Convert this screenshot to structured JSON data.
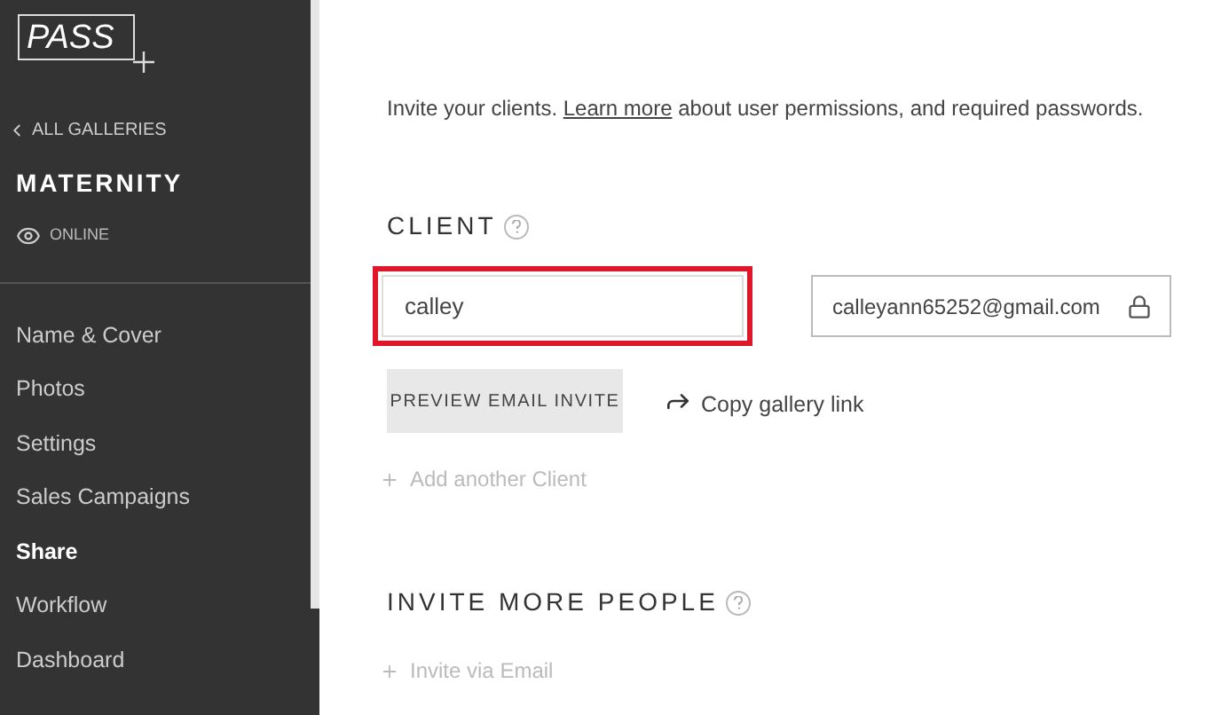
{
  "sidebar": {
    "logo": "PASS",
    "back_link": "ALL GALLERIES",
    "gallery_title": "MATERNITY",
    "status": "ONLINE",
    "items": [
      {
        "label": "Name & Cover",
        "selected": false
      },
      {
        "label": "Photos",
        "selected": false
      },
      {
        "label": "Settings",
        "selected": false
      },
      {
        "label": "Sales Campaigns",
        "selected": false
      },
      {
        "label": "Share",
        "selected": true
      },
      {
        "label": "Workflow",
        "selected": false
      },
      {
        "label": "Dashboard",
        "selected": false
      }
    ]
  },
  "intro": {
    "before": "Invite your clients. ",
    "link": "Learn more",
    "after": " about user permissions, and required passwords."
  },
  "client": {
    "heading": "CLIENT",
    "name_value": "calley",
    "name_highlighted": true,
    "email_value": "calleyann65252@gmail.com",
    "preview_button": "PREVIEW EMAIL INVITE",
    "copy_link": "Copy gallery link",
    "add_another": "Add another Client"
  },
  "invite_more": {
    "heading": "INVITE MORE PEOPLE",
    "invite_email": "Invite via Email"
  }
}
